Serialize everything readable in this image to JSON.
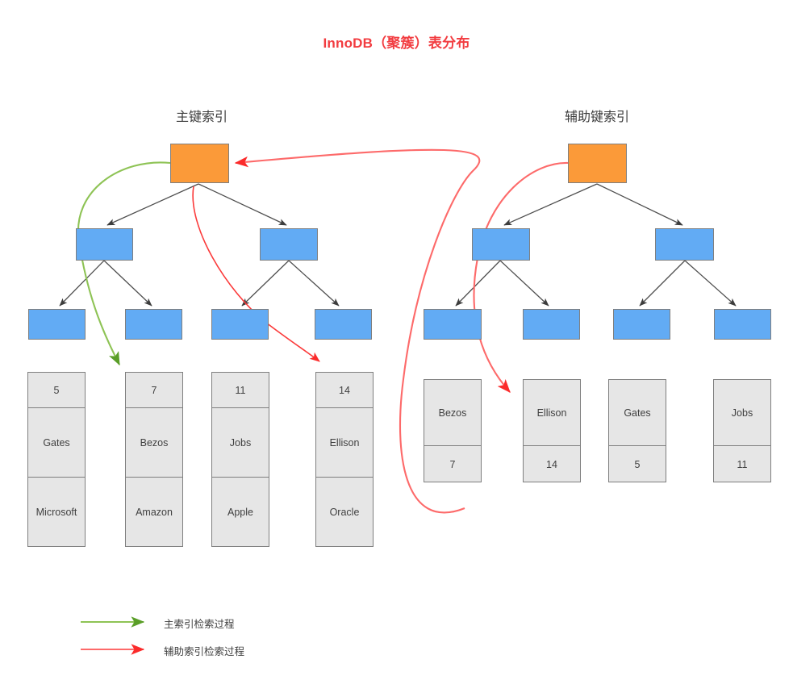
{
  "page": {
    "title": "InnoDB（聚簇）表分布",
    "title_color": "#f23c40",
    "background": "#ffffff"
  },
  "colors": {
    "root_node": "#fb9a39",
    "branch_node": "#62abf4",
    "card_fill": "#e6e6e6",
    "node_border": "#7f7f7f",
    "tree_edge": "#4d4d4d",
    "primary_trace": "#70ad47",
    "secondary_trace": "#ff4040"
  },
  "primary_index": {
    "heading": "主键索引",
    "tree": {
      "root": {
        "label": "",
        "kind": "root-node"
      },
      "level2": [
        {
          "label": ""
        },
        {
          "label": ""
        }
      ],
      "level3": [
        {
          "label": ""
        },
        {
          "label": ""
        },
        {
          "label": ""
        },
        {
          "label": ""
        }
      ]
    },
    "records": [
      {
        "key": "5",
        "name": "Gates",
        "company": "Microsoft"
      },
      {
        "key": "7",
        "name": "Bezos",
        "company": "Amazon"
      },
      {
        "key": "11",
        "name": "Jobs",
        "company": "Apple"
      },
      {
        "key": "14",
        "name": "Ellison",
        "company": "Oracle"
      }
    ]
  },
  "secondary_index": {
    "heading": "辅助键索引",
    "tree": {
      "root": {
        "label": "",
        "kind": "root-node"
      },
      "level2": [
        {
          "label": ""
        },
        {
          "label": ""
        }
      ],
      "level3": [
        {
          "label": ""
        },
        {
          "label": ""
        },
        {
          "label": ""
        },
        {
          "label": ""
        }
      ]
    },
    "records": [
      {
        "name": "Bezos",
        "key": "7"
      },
      {
        "name": "Ellison",
        "key": "14"
      },
      {
        "name": "Gates",
        "key": "5"
      },
      {
        "name": "Jobs",
        "key": "11"
      }
    ]
  },
  "legend": [
    {
      "label": "主索引检索过程",
      "color": "#70ad47"
    },
    {
      "label": "辅助索引检索过程",
      "color": "#ff4040"
    }
  ]
}
